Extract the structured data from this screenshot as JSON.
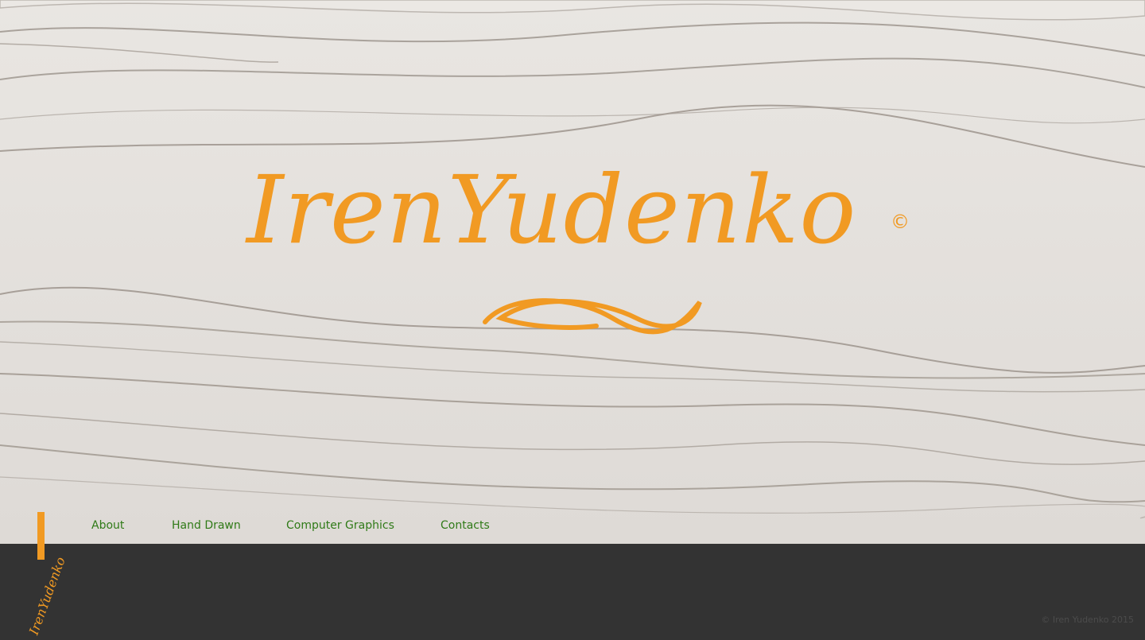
{
  "brand": {
    "logo_text": "IrenYudenko",
    "copyright_mark": "©",
    "side_signature": "IrenYudenko",
    "accent_color": "#f19a23"
  },
  "nav": {
    "items": [
      {
        "label": "About"
      },
      {
        "label": "Hand Drawn"
      },
      {
        "label": "Computer Graphics"
      },
      {
        "label": "Contacts"
      }
    ],
    "link_color": "#2f7a17"
  },
  "footer": {
    "copyright": "© Iren Yudenko 2015",
    "background": "#333333"
  }
}
